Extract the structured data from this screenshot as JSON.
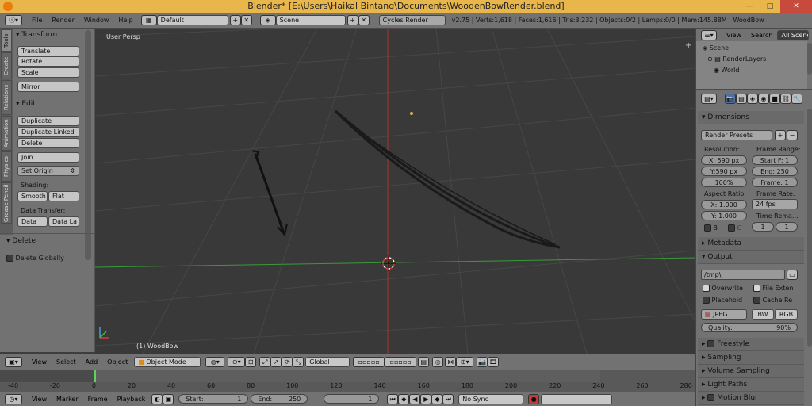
{
  "window": {
    "title": "Blender* [E:\\Users\\Haikal Bintang\\Documents\\WoodenBowRender.blend]",
    "min": "—",
    "max": "□",
    "close": "✕"
  },
  "menubar": {
    "file": "File",
    "render": "Render",
    "window": "Window",
    "help": "Help",
    "screen_layout": "Default",
    "scene": "Scene",
    "engine": "Cycles Render",
    "stats": "v2.75 | Verts:1,618 | Faces:1,616 | Tris:3,232 | Objects:0/2 | Lamps:0/0 | Mem:145.88M | WoodBow"
  },
  "toolshelf": {
    "tabs": [
      "Tools",
      "Create",
      "Relations",
      "Animation",
      "Physics",
      "Grease Pencil"
    ],
    "transform": {
      "title": "Transform",
      "translate": "Translate",
      "rotate": "Rotate",
      "scale": "Scale",
      "mirror": "Mirror"
    },
    "edit": {
      "title": "Edit",
      "duplicate": "Duplicate",
      "duplicate_linked": "Duplicate Linked",
      "delete": "Delete",
      "join": "Join",
      "set_origin": "Set Origin",
      "shading": "Shading:",
      "smooth": "Smooth",
      "flat": "Flat",
      "data_transfer": "Data Transfer:",
      "data": "Data",
      "data_la": "Data La"
    },
    "delete_panel": {
      "title": "Delete",
      "delete_globally": "Delete Globally"
    }
  },
  "viewport": {
    "view_name": "User Persp",
    "object_label": "(1) WoodBow"
  },
  "viewport_header": {
    "view": "View",
    "select": "Select",
    "add": "Add",
    "object": "Object",
    "mode": "Object Mode",
    "orientation": "Global"
  },
  "timeline": {
    "ticks": [
      "-40",
      "-20",
      "0",
      "20",
      "40",
      "60",
      "80",
      "100",
      "120",
      "140",
      "160",
      "180",
      "200",
      "220",
      "240",
      "260",
      "280"
    ],
    "view": "View",
    "marker": "Marker",
    "frame": "Frame",
    "playback": "Playback",
    "start_label": "Start:",
    "start_value": "1",
    "end_label": "End:",
    "end_value": "250",
    "current": "1",
    "sync": "No Sync"
  },
  "outliner": {
    "view": "View",
    "search": "Search",
    "all_scenes": "All Scene",
    "scene": "Scene",
    "render_layers": "RenderLayers",
    "world": "World"
  },
  "properties": {
    "dimensions": "Dimensions",
    "render_presets": "Render Presets",
    "resolution": "Resolution:",
    "res_x": "X: 590 px",
    "res_y": "Y:590 px",
    "res_pct": "100%",
    "frame_range": "Frame Range:",
    "start_f": "Start F: 1",
    "end": "End: 250",
    "frame": "Frame: 1",
    "aspect_ratio": "Aspect Ratio:",
    "asp_x": "X: 1.000",
    "asp_y": "Y: 1.000",
    "frame_rate": "Frame Rate:",
    "fps": "24 fps",
    "time_remap": "Time Rema...",
    "remap_old": "1",
    "remap_new": "1",
    "b": "B",
    "c": "C",
    "metadata": "Metadata",
    "output": "Output",
    "path": "/tmp\\",
    "overwrite": "Overwrite",
    "file_ext": "File Exten",
    "placeholders": "Placehold",
    "cache_re": "Cache Re",
    "format": "JPEG",
    "bw": "BW",
    "rgb": "RGB",
    "quality_label": "Quality:",
    "quality_value": "90%",
    "freestyle": "Freestyle",
    "sampling": "Sampling",
    "volume_sampling": "Volume Sampling",
    "light_paths": "Light Paths",
    "motion_blur": "Motion Blur"
  },
  "colors": {
    "x_axis": "#b03030",
    "y_axis": "#3a9a3a",
    "title_bar": "#e8b64a",
    "panel": "#727272",
    "viewport": "#393939"
  }
}
